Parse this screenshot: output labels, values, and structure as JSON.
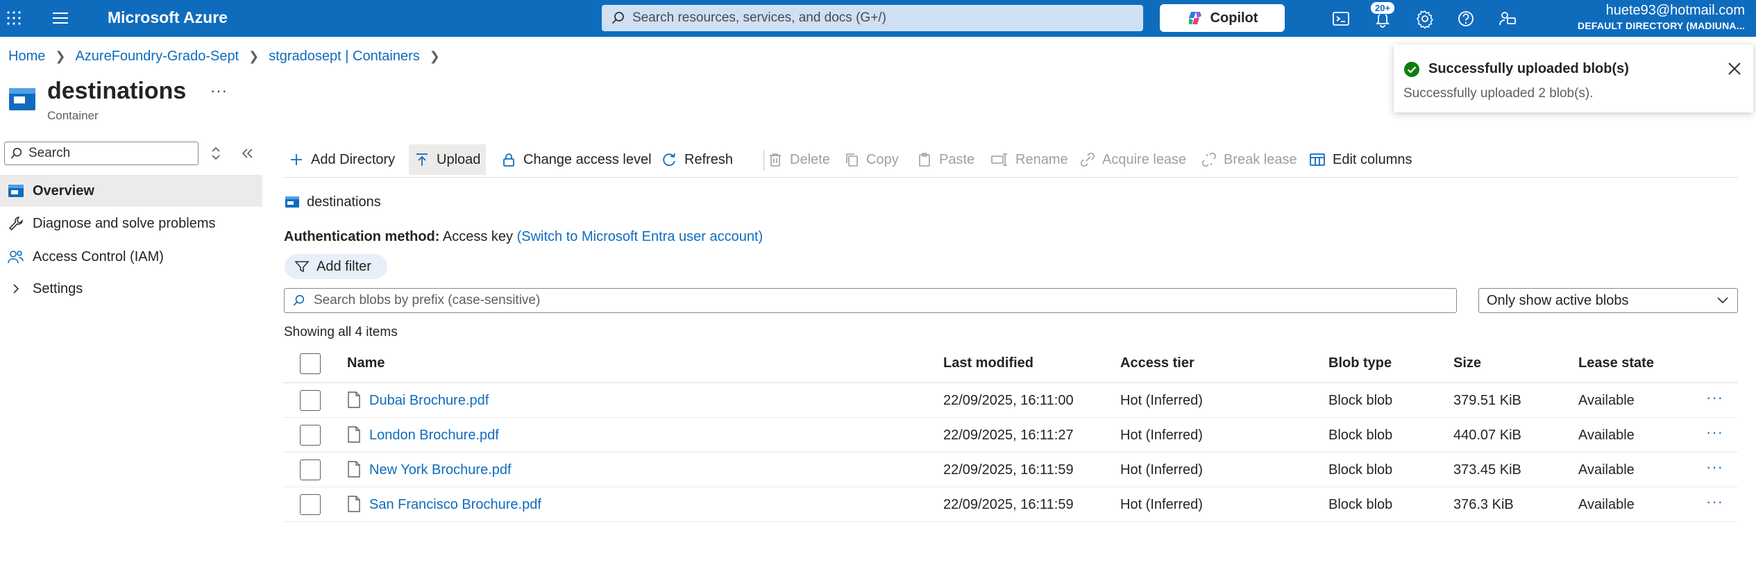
{
  "topbar": {
    "brand": "Microsoft Azure",
    "search_placeholder": "Search resources, services, and docs (G+/)",
    "copilot_label": "Copilot",
    "notification_badge": "20+",
    "account_email": "huete93@hotmail.com",
    "account_directory": "DEFAULT DIRECTORY (MADIUNA..."
  },
  "breadcrumb": {
    "items": [
      "Home",
      "AzureFoundry-Grado-Sept",
      "stgradosept | Containers"
    ]
  },
  "page": {
    "title": "destinations",
    "subtitle": "Container",
    "more": "···"
  },
  "toast": {
    "title": "Successfully uploaded blob(s)",
    "message": "Successfully uploaded 2 blob(s)."
  },
  "left_nav": {
    "search_placeholder": "Search",
    "items": [
      {
        "label": "Overview",
        "icon": "container-icon"
      },
      {
        "label": "Diagnose and solve problems",
        "icon": "wrench-icon"
      },
      {
        "label": "Access Control (IAM)",
        "icon": "people-icon"
      },
      {
        "label": "Settings",
        "icon": "chevron-right-icon"
      }
    ]
  },
  "toolbar": {
    "add_directory": "Add Directory",
    "upload": "Upload",
    "change_access": "Change access level",
    "refresh": "Refresh",
    "delete": "Delete",
    "copy": "Copy",
    "paste": "Paste",
    "rename": "Rename",
    "acquire_lease": "Acquire lease",
    "break_lease": "Break lease",
    "edit_columns": "Edit columns"
  },
  "container_label": "destinations",
  "auth": {
    "label": "Authentication method:",
    "value": "Access key",
    "switch_link": "(Switch to Microsoft Entra user account)"
  },
  "filter": {
    "add_filter": "Add filter",
    "search_placeholder": "Search blobs by prefix (case-sensitive)",
    "select_value": "Only show active blobs"
  },
  "count_text": "Showing all 4 items",
  "table": {
    "headers": {
      "name": "Name",
      "modified": "Last modified",
      "tier": "Access tier",
      "type": "Blob type",
      "size": "Size",
      "lease": "Lease state"
    },
    "rows": [
      {
        "name": "Dubai Brochure.pdf",
        "modified": "22/09/2025, 16:11:00",
        "tier": "Hot (Inferred)",
        "type": "Block blob",
        "size": "379.51 KiB",
        "lease": "Available"
      },
      {
        "name": "London Brochure.pdf",
        "modified": "22/09/2025, 16:11:27",
        "tier": "Hot (Inferred)",
        "type": "Block blob",
        "size": "440.07 KiB",
        "lease": "Available"
      },
      {
        "name": "New York Brochure.pdf",
        "modified": "22/09/2025, 16:11:59",
        "tier": "Hot (Inferred)",
        "type": "Block blob",
        "size": "373.45 KiB",
        "lease": "Available"
      },
      {
        "name": "San Francisco Brochure.pdf",
        "modified": "22/09/2025, 16:11:59",
        "tier": "Hot (Inferred)",
        "type": "Block blob",
        "size": "376.3 KiB",
        "lease": "Available"
      }
    ],
    "row_more": "···"
  },
  "colors": {
    "topbar": "#0f6cbd",
    "link": "#0f6cbd",
    "success": "#107c10"
  }
}
